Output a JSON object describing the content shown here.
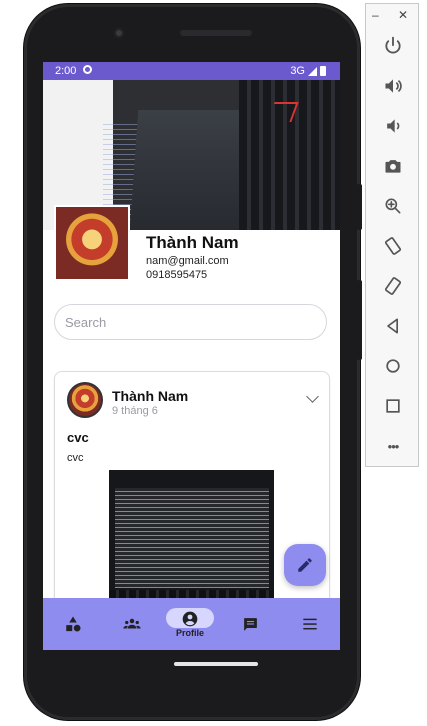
{
  "emulator_toolbar": {
    "minimize_label": "–",
    "close_label": "✕",
    "buttons": [
      "power-icon",
      "volume-up-icon",
      "volume-down-icon",
      "camera-icon",
      "zoom-icon",
      "rotate-left-icon",
      "rotate-right-icon",
      "back-icon",
      "home-icon",
      "overview-icon",
      "more-icon"
    ],
    "more_label": "•••"
  },
  "status_bar": {
    "time": "2:00",
    "network": "3G"
  },
  "profile": {
    "name": "Thành Nam",
    "email": "nam@gmail.com",
    "phone": "0918595475"
  },
  "search": {
    "placeholder": "Search"
  },
  "post": {
    "author": "Thành Nam",
    "time": "9 tháng 6",
    "title": "cvc",
    "body": "cvc"
  },
  "bottom_nav": {
    "active": "Profile",
    "profile_label": "Profile"
  },
  "colors": {
    "accent": "#8f8cf0",
    "status_bar": "#6a5acd",
    "active_pill": "#d7d6ff"
  }
}
